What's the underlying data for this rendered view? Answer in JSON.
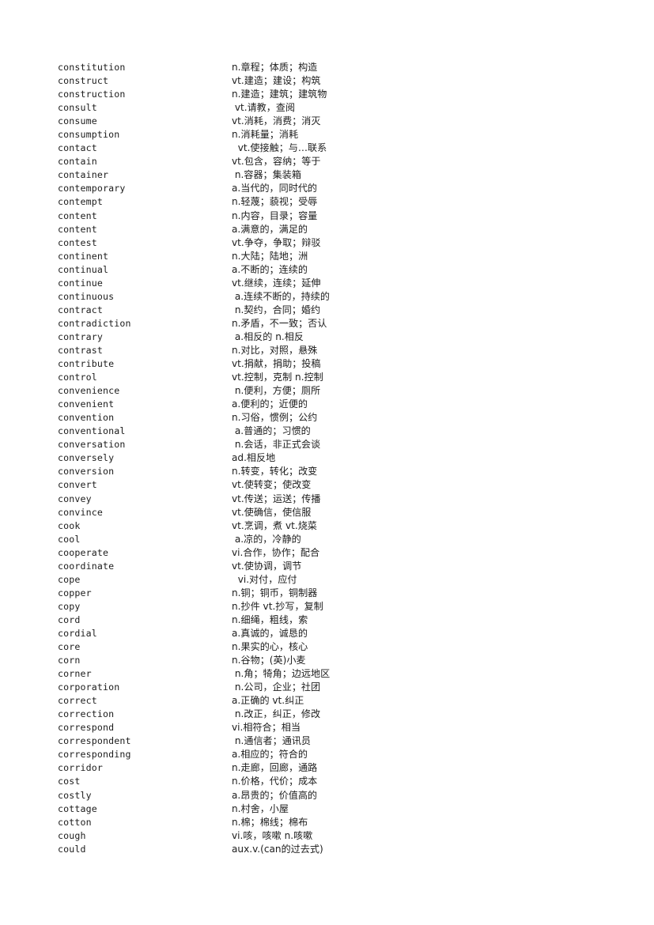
{
  "document": {
    "type": "vocabulary-list",
    "language_pair": "English-Chinese",
    "background_color": "#ffffff",
    "text_color": "#1c1c1c"
  },
  "entries": [
    {
      "word": "constitution",
      "definition": "n.章程；体质；构造"
    },
    {
      "word": "construct",
      "definition": "vt.建造；建设；构筑"
    },
    {
      "word": "construction",
      "definition": "n.建造；建筑；建筑物"
    },
    {
      "word": "consult",
      "definition": " vt.请教，查阅"
    },
    {
      "word": "consume",
      "definition": "vt.消耗，消费；消灭"
    },
    {
      "word": "consumption",
      "definition": "n.消耗量；消耗"
    },
    {
      "word": "contact",
      "definition": "  vt.使接触；与…联系"
    },
    {
      "word": "contain",
      "definition": "vt.包含，容纳；等于"
    },
    {
      "word": "container",
      "definition": " n.容器；集装箱"
    },
    {
      "word": "contemporary",
      "definition": "a.当代的，同时代的"
    },
    {
      "word": "contempt",
      "definition": "n.轻蔑；藐视；受辱"
    },
    {
      "word": "content",
      "definition": "n.内容，目录；容量"
    },
    {
      "word": "content",
      "definition": "a.满意的，满足的"
    },
    {
      "word": "contest",
      "definition": "vt.争夺，争取；辩驳"
    },
    {
      "word": "continent",
      "definition": "n.大陆；陆地；洲"
    },
    {
      "word": "continual",
      "definition": "a.不断的；连续的"
    },
    {
      "word": "continue",
      "definition": "vt.继续，连续；延伸"
    },
    {
      "word": "continuous",
      "definition": " a.连续不断的，持续的"
    },
    {
      "word": "contract",
      "definition": " n.契约，合同；婚约"
    },
    {
      "word": "contradiction",
      "definition": "n.矛盾，不一致；否认"
    },
    {
      "word": "contrary",
      "definition": " a.相反的 n.相反"
    },
    {
      "word": "contrast",
      "definition": "n.对比，对照，悬殊"
    },
    {
      "word": "contribute",
      "definition": "vt.捐献，捐助；投稿"
    },
    {
      "word": "control",
      "definition": "vt.控制，克制 n.控制"
    },
    {
      "word": "convenience",
      "definition": " n.便利，方便；厕所"
    },
    {
      "word": "convenient",
      "definition": "a.便利的；近便的"
    },
    {
      "word": "convention",
      "definition": "n.习俗，惯例；公约"
    },
    {
      "word": "conventional",
      "definition": " a.普通的；习惯的"
    },
    {
      "word": "conversation",
      "definition": " n.会话，非正式会谈"
    },
    {
      "word": "conversely",
      "definition": "ad.相反地"
    },
    {
      "word": "conversion",
      "definition": "n.转变，转化；改变"
    },
    {
      "word": "convert",
      "definition": "vt.使转变；使改变"
    },
    {
      "word": "convey",
      "definition": "vt.传送；运送；传播"
    },
    {
      "word": "convince",
      "definition": "vt.使确信，使信服"
    },
    {
      "word": "cook",
      "definition": "vt.烹调，煮 vt.烧菜"
    },
    {
      "word": "cool",
      "definition": " a.凉的，冷静的"
    },
    {
      "word": "cooperate",
      "definition": "vi.合作，协作；配合"
    },
    {
      "word": "coordinate",
      "definition": "vt.使协调，调节"
    },
    {
      "word": "cope",
      "definition": "  vi.对付，应付"
    },
    {
      "word": "copper",
      "definition": "n.铜；铜币，铜制器"
    },
    {
      "word": "copy",
      "definition": "n.抄件 vt.抄写，复制"
    },
    {
      "word": "cord",
      "definition": "n.细绳，粗线，索"
    },
    {
      "word": "cordial",
      "definition": "a.真诚的，诚恳的"
    },
    {
      "word": "core",
      "definition": "n.果实的心，核心"
    },
    {
      "word": "corn",
      "definition": "n.谷物；(英)小麦"
    },
    {
      "word": "corner",
      "definition": " n.角；犄角；边远地区"
    },
    {
      "word": "corporation",
      "definition": " n.公司，企业；社团"
    },
    {
      "word": "correct",
      "definition": "a.正确的 vt.纠正"
    },
    {
      "word": "correction",
      "definition": " n.改正，纠正，修改"
    },
    {
      "word": "correspond",
      "definition": "vi.相符合；相当"
    },
    {
      "word": "correspondent",
      "definition": " n.通信者；通讯员"
    },
    {
      "word": "corresponding",
      "definition": "a.相应的；符合的"
    },
    {
      "word": "corridor",
      "definition": "n.走廊，回廊，通路"
    },
    {
      "word": "cost",
      "definition": "n.价格，代价；成本"
    },
    {
      "word": "costly",
      "definition": "a.昂贵的；价值高的"
    },
    {
      "word": "cottage",
      "definition": "n.村舍，小屋"
    },
    {
      "word": "cotton",
      "definition": "n.棉；棉线；棉布"
    },
    {
      "word": "cough",
      "definition": "vi.咳，咳嗽 n.咳嗽"
    },
    {
      "word": "could",
      "definition": "aux.v.(can的过去式)"
    }
  ]
}
